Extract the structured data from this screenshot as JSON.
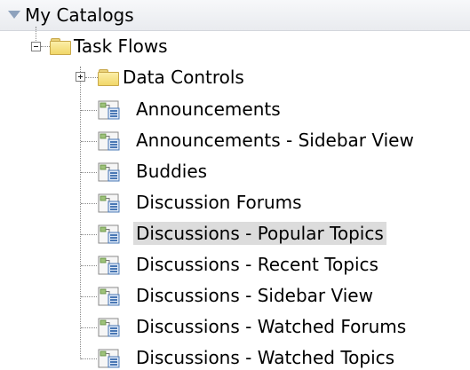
{
  "header": {
    "title": "My Catalogs"
  },
  "tree": {
    "root": {
      "label": "Task Flows",
      "expanded": true
    },
    "folder": {
      "label": "Data Controls",
      "expanded": false
    },
    "items": [
      {
        "label": "Announcements",
        "selected": false
      },
      {
        "label": "Announcements - Sidebar View",
        "selected": false
      },
      {
        "label": "Buddies",
        "selected": false
      },
      {
        "label": "Discussion Forums",
        "selected": false
      },
      {
        "label": "Discussions - Popular Topics",
        "selected": true
      },
      {
        "label": "Discussions - Recent Topics",
        "selected": false
      },
      {
        "label": "Discussions - Sidebar View",
        "selected": false
      },
      {
        "label": "Discussions - Watched Forums",
        "selected": false
      },
      {
        "label": "Discussions - Watched Topics",
        "selected": false
      }
    ]
  },
  "colors": {
    "selection_bg": "#dcdcdc",
    "header_caret": "#8ea2bd",
    "folder_fill": "#f1d769"
  },
  "icons": {
    "collapse_toggle": "minus-box-icon",
    "expand_toggle": "plus-box-icon",
    "folder": "folder-icon",
    "task_flow": "task-flow-icon",
    "header_caret": "triangle-down-icon"
  }
}
